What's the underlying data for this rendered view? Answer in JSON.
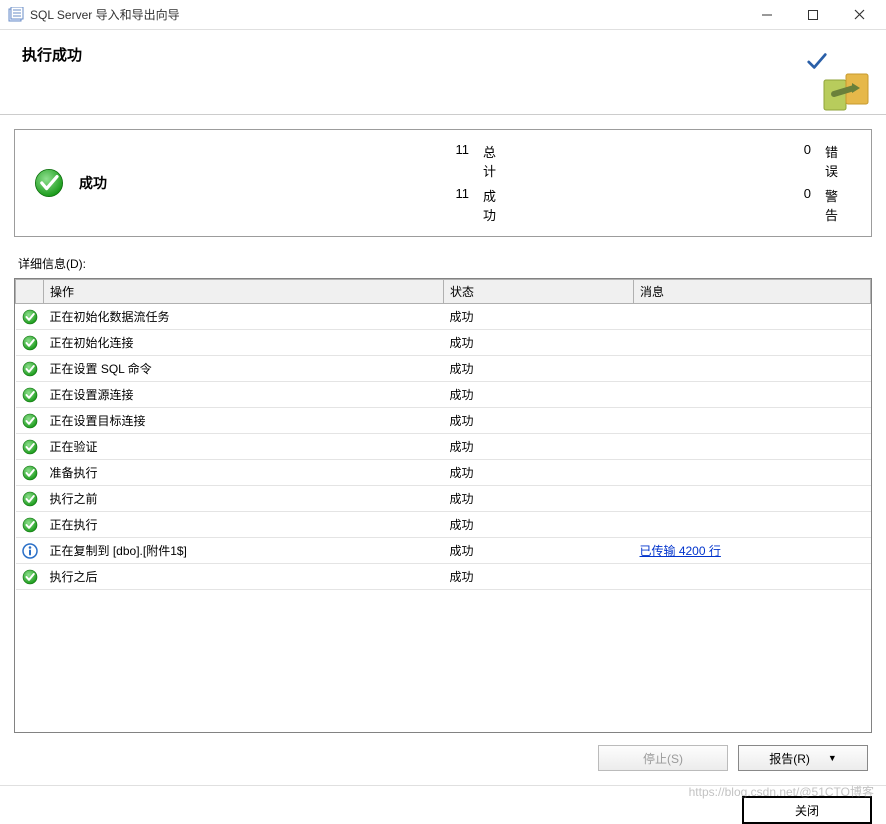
{
  "window": {
    "title": "SQL Server 导入和导出向导"
  },
  "header": {
    "page_title": "执行成功"
  },
  "summary": {
    "status_label": "成功",
    "total_count": "11",
    "total_label": "总计",
    "error_count": "0",
    "error_label": "错误",
    "success_count": "11",
    "success_label": "成功",
    "warning_count": "0",
    "warning_label": "警告"
  },
  "details": {
    "label": "详细信息(D):",
    "columns": {
      "action": "操作",
      "status": "状态",
      "message": "消息"
    },
    "rows": [
      {
        "icon": "success",
        "action": "正在初始化数据流任务",
        "status": "成功",
        "message": ""
      },
      {
        "icon": "success",
        "action": "正在初始化连接",
        "status": "成功",
        "message": ""
      },
      {
        "icon": "success",
        "action": "正在设置 SQL 命令",
        "status": "成功",
        "message": ""
      },
      {
        "icon": "success",
        "action": "正在设置源连接",
        "status": "成功",
        "message": ""
      },
      {
        "icon": "success",
        "action": "正在设置目标连接",
        "status": "成功",
        "message": ""
      },
      {
        "icon": "success",
        "action": "正在验证",
        "status": "成功",
        "message": ""
      },
      {
        "icon": "success",
        "action": "准备执行",
        "status": "成功",
        "message": ""
      },
      {
        "icon": "success",
        "action": "执行之前",
        "status": "成功",
        "message": ""
      },
      {
        "icon": "success",
        "action": "正在执行",
        "status": "成功",
        "message": ""
      },
      {
        "icon": "info",
        "action": "正在复制到 [dbo].[附件1$]",
        "status": "成功",
        "message": "已传输 4200 行",
        "message_link": true
      },
      {
        "icon": "success",
        "action": "执行之后",
        "status": "成功",
        "message": ""
      }
    ]
  },
  "buttons": {
    "stop": "停止(S)",
    "report": "报告(R)",
    "close": "关闭"
  },
  "watermark": "https://blog.csdn.net/@51CTO博客"
}
